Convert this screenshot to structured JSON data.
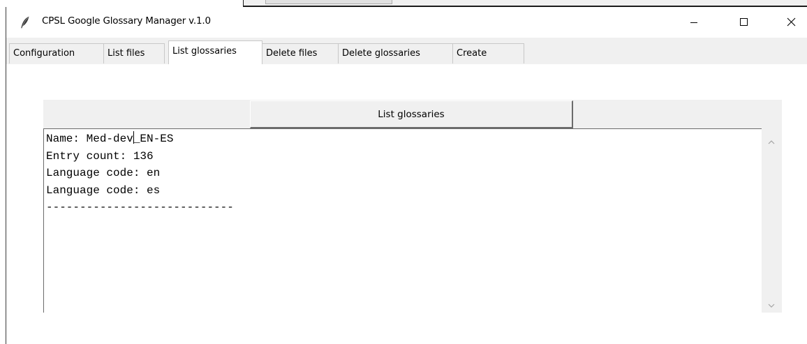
{
  "window": {
    "title": "CPSL Google Glossary Manager v.1.0"
  },
  "tabs": [
    {
      "label": "Configuration",
      "active": false
    },
    {
      "label": "List files",
      "active": false
    },
    {
      "label": "List glossaries",
      "active": true
    },
    {
      "label": "Delete files",
      "active": false
    },
    {
      "label": "Delete glossaries",
      "active": false
    },
    {
      "label": "Create",
      "active": false
    }
  ],
  "panel": {
    "button_label": "List glossaries",
    "output_lines": [
      "Name: Med-dev_EN-ES",
      "Entry count: 136",
      "Language code: en",
      "Language code: es",
      "----------------------------"
    ]
  },
  "icons": {
    "app": "feather-icon",
    "minimize": "minimize-icon",
    "maximize": "maximize-icon",
    "close": "close-icon",
    "scroll_up": "chevron-up-icon",
    "scroll_down": "chevron-down-icon"
  },
  "colors": {
    "window_bg": "#f0f0f0",
    "content_bg": "#ffffff",
    "text": "#000000"
  }
}
